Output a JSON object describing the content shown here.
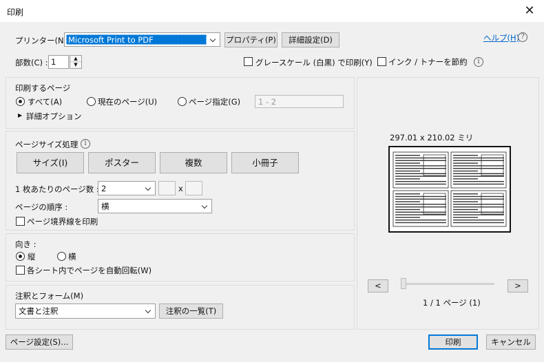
{
  "dialog": {
    "title": "印刷"
  },
  "printer": {
    "label": "プリンター(N) :",
    "selected": "Microsoft Print to PDF",
    "properties_button": "プロパティ(P)",
    "advanced_button": "詳細設定(D)",
    "help_link": "ヘルプ(H)"
  },
  "copies": {
    "label": "部数(C) :",
    "value": "1",
    "grayscale_label": "グレースケール (白黒) で印刷(Y)",
    "save_ink_label": "インク / トナーを節約"
  },
  "pages": {
    "heading": "印刷するページ",
    "all_label": "すべて(A)",
    "current_label": "現在のページ(U)",
    "range_label": "ページ指定(G)",
    "range_placeholder": "1 - 2",
    "more_options": "詳細オプション",
    "selected": "all"
  },
  "page_sizing": {
    "heading": "ページサイズ処理",
    "buttons": [
      "サイズ(I)",
      "ポスター",
      "複数",
      "小冊子"
    ],
    "pages_per_sheet_label": "1 枚あたりのページ数 :",
    "pages_per_sheet_value": "2",
    "times_symbol": "x",
    "page_order_label": "ページの順序 :",
    "page_order_value": "横",
    "print_borders_label": "ページ境界線を印刷"
  },
  "orientation": {
    "heading": "向き :",
    "portrait_label": "縦",
    "landscape_label": "横",
    "selected": "portrait",
    "auto_rotate_label": "各シート内でページを自動回転(W)"
  },
  "comments": {
    "heading": "注釈とフォーム(M)",
    "selected": "文書と注釈",
    "summary_button": "注釈の一覧(T)"
  },
  "preview": {
    "size_text": "297.01 x 210.02 ミリ",
    "prev_button": "<",
    "next_button": ">",
    "page_indicator": "1 / 1 ページ (1)"
  },
  "footer": {
    "page_setup_button": "ページ設定(S)...",
    "print_button": "印刷",
    "cancel_button": "キャンセル"
  },
  "colors": {
    "selection_blue": "#0078d7",
    "link_blue": "#0066cc",
    "button_gray": "#e1e1e1",
    "panel_gray": "#f0f0f0"
  }
}
